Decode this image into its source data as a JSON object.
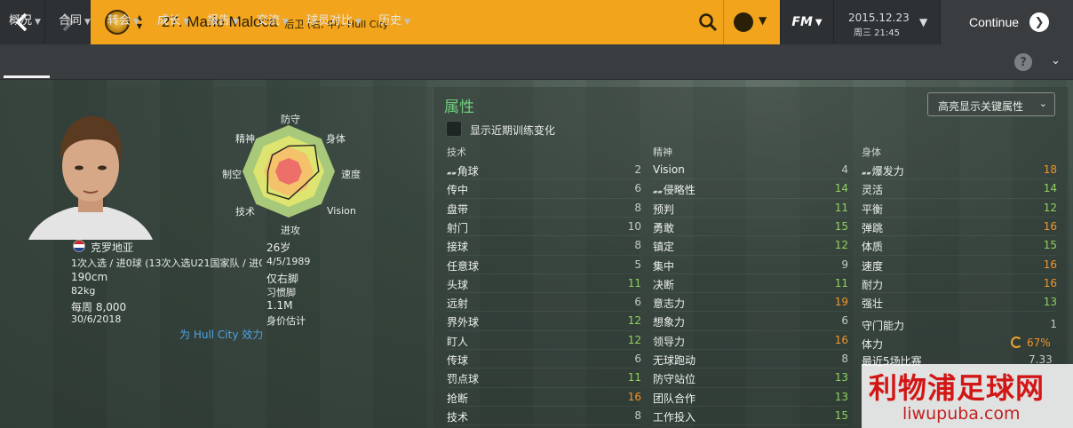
{
  "topbar": {
    "player_title": "27. Mario Maloca",
    "player_sub": "后卫 (右, 中)- Hull City",
    "fm_label": "FM",
    "date": "2015.12.23",
    "time": "周三 21:45",
    "continue_label": "Continue"
  },
  "tabs": [
    {
      "label": "概况"
    },
    {
      "label": "合同"
    },
    {
      "label": "转会"
    },
    {
      "label": "成长"
    },
    {
      "label": "报告"
    },
    {
      "label": "交流"
    },
    {
      "label": "球员对比"
    },
    {
      "label": "历史"
    }
  ],
  "profile": {
    "nationality": "克罗地亚",
    "age": "26岁",
    "caps": "1次入选 / 进0球 (13次入选U21国家队 / 进0…",
    "dob": "4/5/1989",
    "height": "190cm",
    "foot": "仅右脚",
    "weight": "82kg",
    "foot_label": "习惯脚",
    "wage": "每周 8,000",
    "value": "1.1M",
    "contract_end": "30/6/2018",
    "value_label": "身价估计",
    "club_link": "为 Hull City 效力"
  },
  "radar": {
    "labels": [
      "防守",
      "身体",
      "速度",
      "Vision",
      "进攻",
      "技术",
      "制空",
      "精神"
    ],
    "values": [
      0.55,
      0.8,
      0.65,
      0.45,
      0.6,
      0.65,
      0.45,
      0.5
    ]
  },
  "attributes": {
    "title": "属性",
    "highlight_select": "高亮显示关键属性",
    "checkbox_label": "显示近期训练变化",
    "key_marker": "ഄ",
    "columns": [
      {
        "header": "技术",
        "rows": [
          {
            "name": "角球",
            "value": "2",
            "key": true
          },
          {
            "name": "传中",
            "value": "6"
          },
          {
            "name": "盘带",
            "value": "8"
          },
          {
            "name": "射门",
            "value": "10"
          },
          {
            "name": "接球",
            "value": "8"
          },
          {
            "name": "任意球",
            "value": "5"
          },
          {
            "name": "头球",
            "value": "11"
          },
          {
            "name": "远射",
            "value": "6"
          },
          {
            "name": "界外球",
            "value": "12"
          },
          {
            "name": "盯人",
            "value": "12"
          },
          {
            "name": "传球",
            "value": "6"
          },
          {
            "name": "罚点球",
            "value": "11"
          },
          {
            "name": "抢断",
            "value": "16"
          },
          {
            "name": "技术",
            "value": "8"
          }
        ]
      },
      {
        "header": "精神",
        "rows": [
          {
            "name": "Vision",
            "value": "4"
          },
          {
            "name": "侵略性",
            "value": "14",
            "key": true
          },
          {
            "name": "预判",
            "value": "11"
          },
          {
            "name": "勇敢",
            "value": "15"
          },
          {
            "name": "镇定",
            "value": "12"
          },
          {
            "name": "集中",
            "value": "9"
          },
          {
            "name": "决断",
            "value": "11"
          },
          {
            "name": "意志力",
            "value": "19"
          },
          {
            "name": "想象力",
            "value": "6"
          },
          {
            "name": "领导力",
            "value": "16"
          },
          {
            "name": "无球跑动",
            "value": "8"
          },
          {
            "name": "防守站位",
            "value": "13"
          },
          {
            "name": "团队合作",
            "value": "13"
          },
          {
            "name": "工作投入",
            "value": "15"
          }
        ]
      },
      {
        "header": "身体",
        "rows": [
          {
            "name": "爆发力",
            "value": "18",
            "key": true
          },
          {
            "name": "灵活",
            "value": "14"
          },
          {
            "name": "平衡",
            "value": "12"
          },
          {
            "name": "弹跳",
            "value": "16"
          },
          {
            "name": "体质",
            "value": "15"
          },
          {
            "name": "速度",
            "value": "16"
          },
          {
            "name": "耐力",
            "value": "16"
          },
          {
            "name": "强壮",
            "value": "13"
          }
        ]
      }
    ],
    "extra": {
      "goalkeeping_label": "守门能力",
      "goalkeeping_value": "1",
      "condition_label": "体力",
      "condition_value": "67%",
      "form_label": "最近5场比赛",
      "form_value": "7.33"
    }
  },
  "watermark": {
    "main": "利物浦足球网",
    "sub": "liwupuba.com"
  },
  "colors": {
    "accent": "#f2a41c",
    "attr_title": "#6fce7e",
    "val_gray": "#c4c9c6",
    "val_green": "#8fd15f",
    "val_orange": "#f0962a",
    "link": "#4fa3e0"
  }
}
